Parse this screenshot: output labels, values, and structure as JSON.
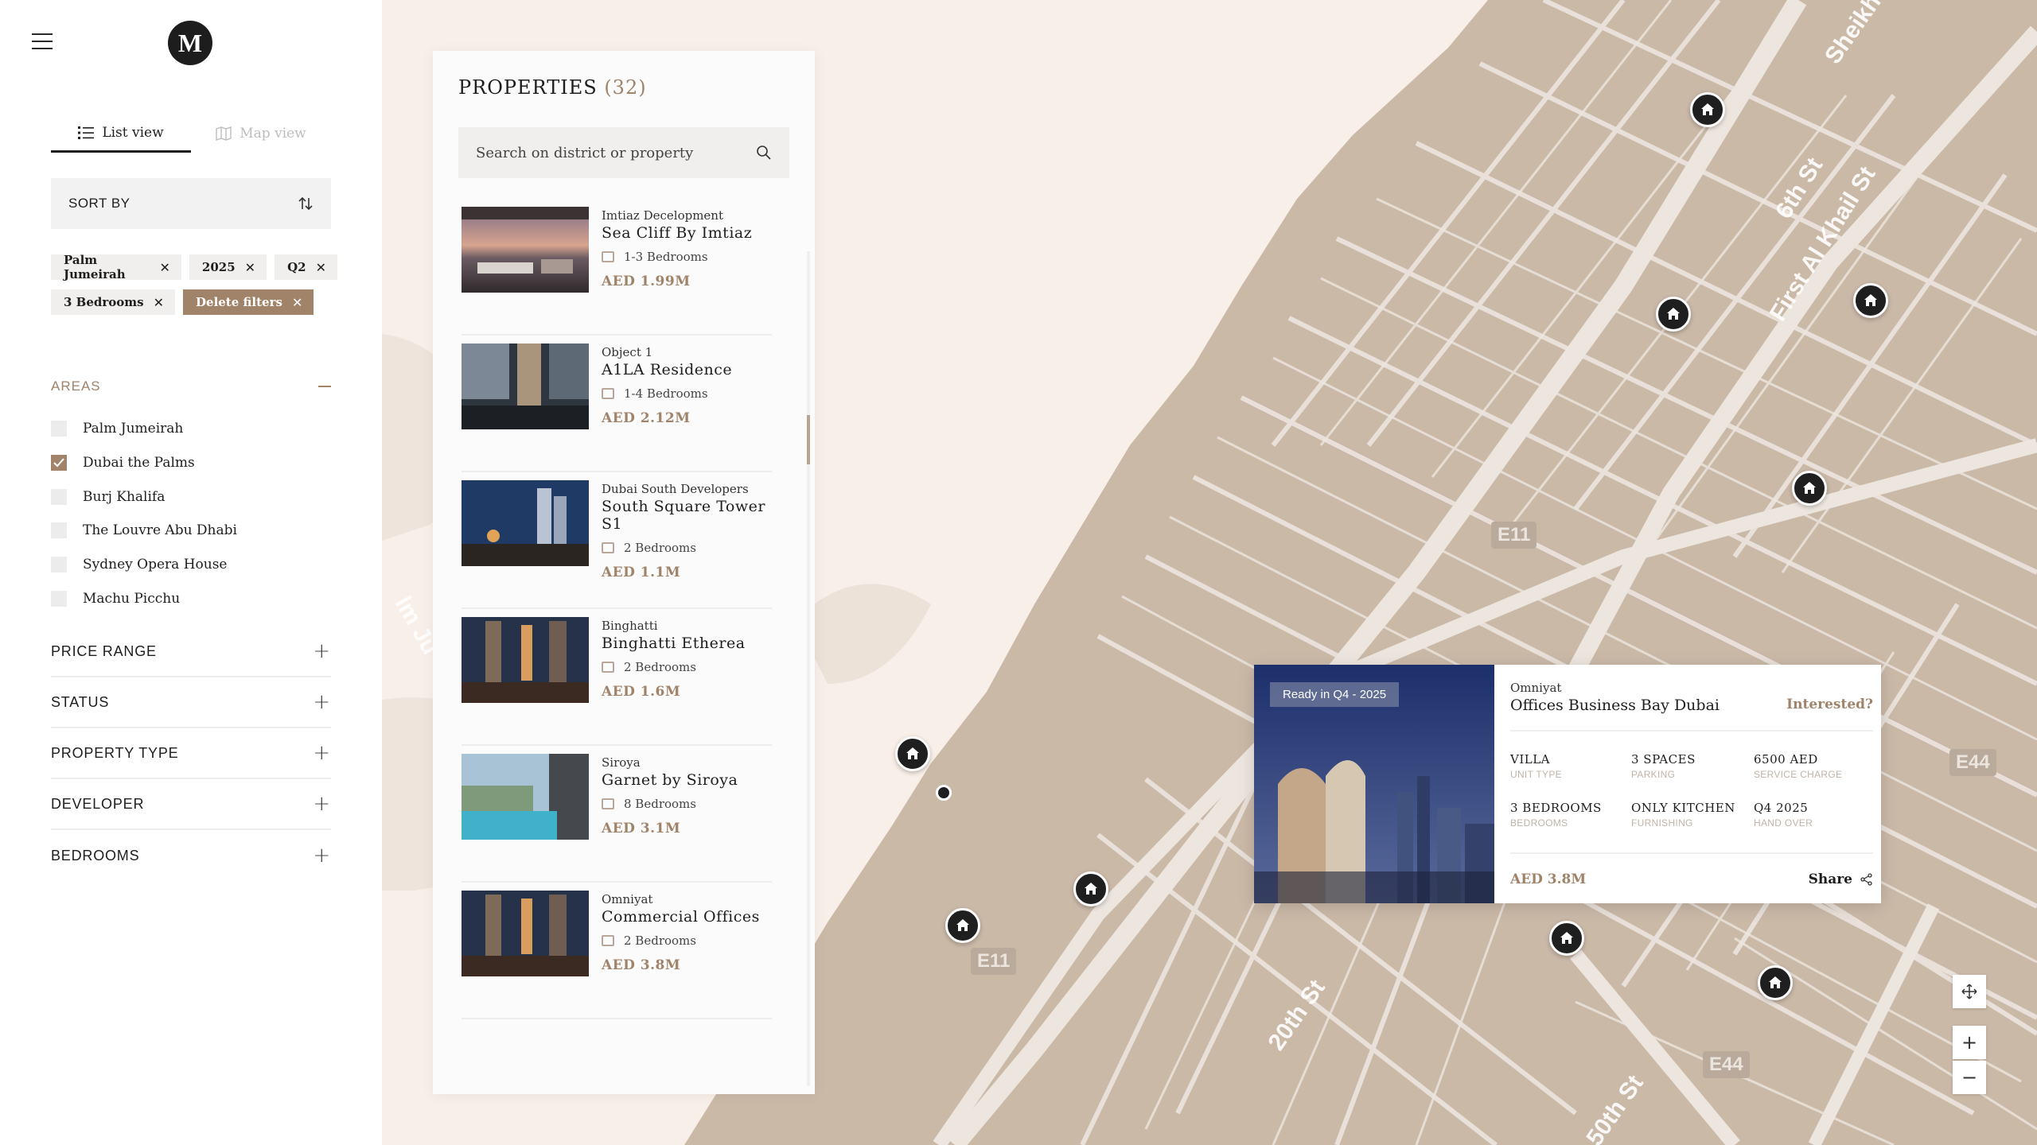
{
  "sidebar": {
    "logo_text": "M",
    "tabs": [
      {
        "label": "List view",
        "icon": "list-icon"
      },
      {
        "label": "Map view",
        "icon": "map-icon"
      }
    ],
    "sort_label": "SORT BY",
    "chips": [
      "Palm Jumeirah",
      "2025",
      "Q2",
      "3 Bedrooms"
    ],
    "delete_filters": "Delete filters",
    "areas_title": "AREAS",
    "areas": [
      {
        "label": "Palm Jumeirah",
        "checked": false
      },
      {
        "label": "Dubai the Palms",
        "checked": true
      },
      {
        "label": "Burj Khalifa",
        "checked": false
      },
      {
        "label": "The Louvre Abu Dhabi",
        "checked": false
      },
      {
        "label": "Sydney Opera House",
        "checked": false
      },
      {
        "label": "Machu Picchu",
        "checked": false
      }
    ],
    "sections": [
      "PRICE RANGE",
      "STATUS",
      "PROPERTY TYPE",
      "DEVELOPER",
      "BEDROOMS"
    ]
  },
  "panel": {
    "title": "PROPERTIES",
    "count": "(32)",
    "search_placeholder": "Search on district or property",
    "properties": [
      {
        "developer": "Imtiaz Decelopment",
        "name": "Sea Cliff By Imtiaz",
        "bedrooms": "1-3 Bedrooms",
        "price": "AED 1.99M"
      },
      {
        "developer": "Object 1",
        "name": "A1LA Residence",
        "bedrooms": "1-4 Bedrooms",
        "price": "AED 2.12M"
      },
      {
        "developer": "Dubai South Developers",
        "name": "South Square Tower S1",
        "bedrooms": "2 Bedrooms",
        "price": "AED 1.1M"
      },
      {
        "developer": "Binghatti",
        "name": "Binghatti Etherea",
        "bedrooms": "2 Bedrooms",
        "price": "AED 1.6M"
      },
      {
        "developer": "Siroya",
        "name": "Garnet by Siroya",
        "bedrooms": "8 Bedrooms",
        "price": "AED 3.1M"
      },
      {
        "developer": "Omniyat",
        "name": "Commercial Offices",
        "bedrooms": "2 Bedrooms",
        "price": "AED 3.8M"
      }
    ]
  },
  "map": {
    "road_labels": [
      "6th St",
      "First Al Khail St",
      "20th St",
      "50th St",
      "Sheikh",
      "lm Ju"
    ],
    "shields": [
      "E11",
      "E11",
      "E44",
      "E44"
    ],
    "colors": {
      "land": "#cbb9a8",
      "water": "#f8efe9",
      "roads": "#ede6df",
      "pin": "#1f1f1f"
    }
  },
  "card": {
    "badge": "Ready in Q4 - 2025",
    "developer": "Omniyat",
    "title": "Offices Business Bay Dubai",
    "interested": "Interested?",
    "specs": [
      {
        "value": "VILLA",
        "label": "UNIT TYPE"
      },
      {
        "value": "3 SPACES",
        "label": "PARKING"
      },
      {
        "value": "6500 AED",
        "label": "SERVICE CHARGE"
      },
      {
        "value": "3 BEDROOMS",
        "label": "BEDROOMS"
      },
      {
        "value": "ONLY KITCHEN",
        "label": "FURNISHING"
      },
      {
        "value": "Q4 2025",
        "label": "HAND OVER"
      }
    ],
    "price": "AED 3.8M",
    "share": "Share"
  },
  "colors": {
    "accent": "#a08369",
    "text": "#1e1e1e"
  }
}
